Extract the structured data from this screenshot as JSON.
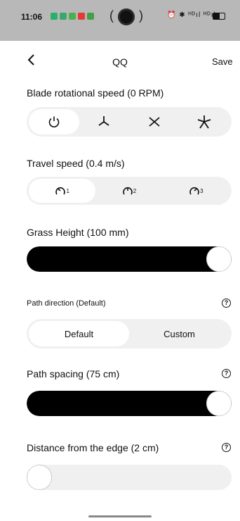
{
  "status_bar": {
    "time": "11:06",
    "signal_text": "⏰ ✱ ᴴᴰıl ᴴᴰıl"
  },
  "header": {
    "back_icon": "chevron-left-icon",
    "title": "QQ",
    "save_label": "Save"
  },
  "blade_speed": {
    "label": "Blade rotational speed (0 RPM)",
    "options": [
      "power-icon",
      "blade-3-icon",
      "blade-4-icon",
      "blade-5-icon"
    ],
    "selected_index": 0
  },
  "travel_speed": {
    "label": "Travel speed (0.4 m/s)",
    "options": [
      "speed-1-icon",
      "speed-2-icon",
      "speed-3-icon"
    ],
    "subscripts": [
      "1",
      "2",
      "3"
    ],
    "selected_index": 0
  },
  "grass_height": {
    "label": "Grass Height (100 mm)",
    "value_fraction": 1.0
  },
  "path_direction": {
    "label": "Path direction (Default)",
    "options": [
      "Default",
      "Custom"
    ],
    "selected_index": 0
  },
  "path_spacing": {
    "label": "Path spacing (75 cm)",
    "value_fraction": 1.0
  },
  "edge_distance": {
    "label": "Distance from the edge (2 cm)",
    "value_fraction": 0.0
  },
  "help_glyph": "?"
}
